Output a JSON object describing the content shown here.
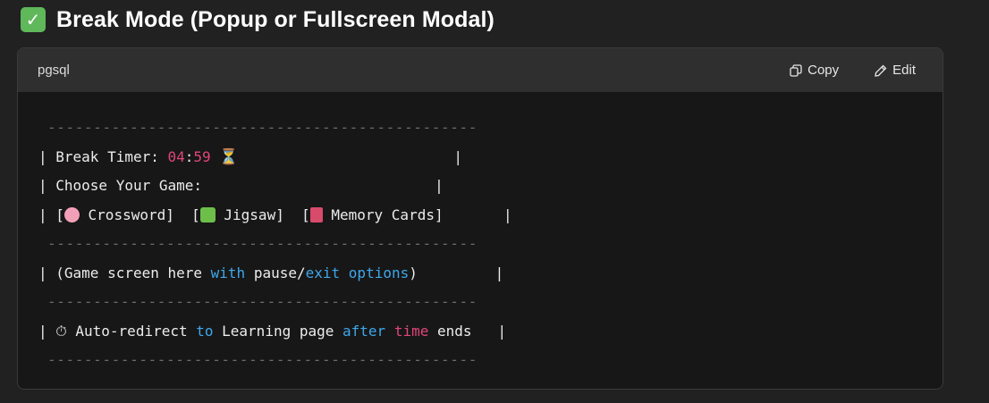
{
  "heading": {
    "icon": "check-mark-button-icon",
    "title": "Break Mode (Popup or Fullscreen Modal)"
  },
  "code_block": {
    "language": "pgsql",
    "copy_label": "Copy",
    "edit_label": "Edit",
    "dash_line": "-----------------------------------------------",
    "timer_label": "| Break Timer: ",
    "timer_minutes": "04",
    "timer_sep": ":",
    "timer_seconds": "59",
    "hourglass": "⏳",
    "timer_end": "|",
    "choose_text": "| Choose Your Game:",
    "choose_end": "|",
    "games_open_1": "| [",
    "game_1": " Crossword]  [",
    "game_2": " Jigsaw]  [",
    "game_3": " Memory Cards]",
    "games_end": "|",
    "game_screen_1": "| (Game screen here ",
    "kw_with": "with",
    "game_screen_2": " pause/",
    "kw_exit": "exit",
    "kw_options": "options",
    "game_screen_3": ")",
    "game_screen_end": "|",
    "stopwatch": "⏱",
    "redirect_1": " Auto-redirect ",
    "kw_to": "to",
    "redirect_2": " Learning page ",
    "kw_after": "after",
    "kw_time": "time",
    "redirect_3": " ends",
    "redirect_end": "|"
  },
  "colors": {
    "background": "#212121",
    "code_background": "#171717",
    "header_background": "#2f2f2f",
    "keyword_pink": "#e0457b",
    "keyword_blue": "#3ea7ea",
    "check_green": "#5fb85a"
  }
}
